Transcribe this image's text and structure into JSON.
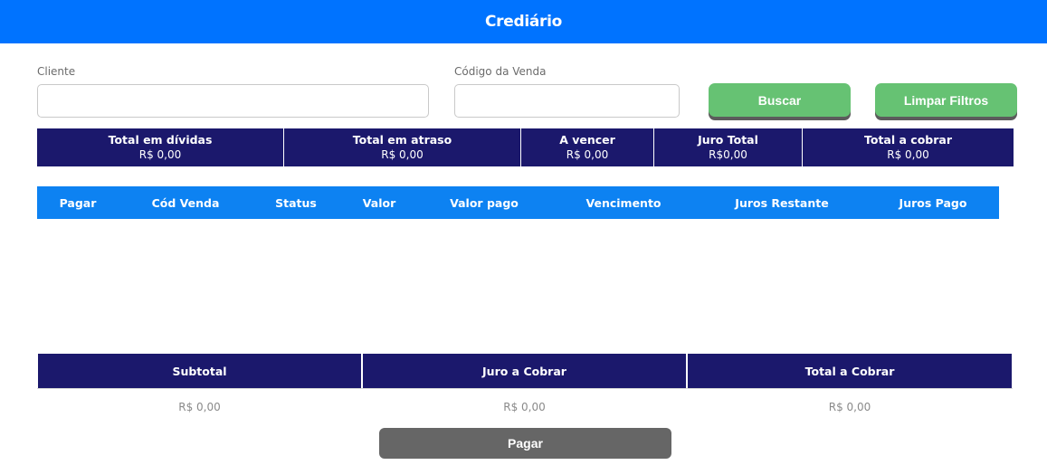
{
  "header": {
    "title": "Crediário"
  },
  "filters": {
    "cliente_label": "Cliente",
    "cliente_value": "",
    "codigo_label": "Código da Venda",
    "codigo_value": "",
    "buscar_label": "Buscar",
    "limpar_label": "Limpar Filtros"
  },
  "summary": [
    {
      "label": "Total em dívidas",
      "value": "R$ 0,00"
    },
    {
      "label": "Total em atraso",
      "value": "R$ 0,00"
    },
    {
      "label": "A vencer",
      "value": "R$ 0,00"
    },
    {
      "label": "Juro Total",
      "value": "R$0,00"
    },
    {
      "label": "Total a cobrar",
      "value": "R$ 0,00"
    }
  ],
  "table": {
    "columns": [
      "Pagar",
      "Cód Venda",
      "Status",
      "Valor",
      "Valor pago",
      "Vencimento",
      "Juros Restante",
      "Juros Pago"
    ],
    "rows": []
  },
  "totals": {
    "headers": [
      "Subtotal",
      "Juro a Cobrar",
      "Total a Cobrar"
    ],
    "values": [
      "R$ 0,00",
      "R$ 0,00",
      "R$ 0,00"
    ]
  },
  "pay_button_label": "Pagar",
  "colors": {
    "topbar": "#0073ff",
    "navy": "#1b186c",
    "table_header": "#0d82f2",
    "green_button": "#66c273",
    "gray_button": "#666666"
  }
}
